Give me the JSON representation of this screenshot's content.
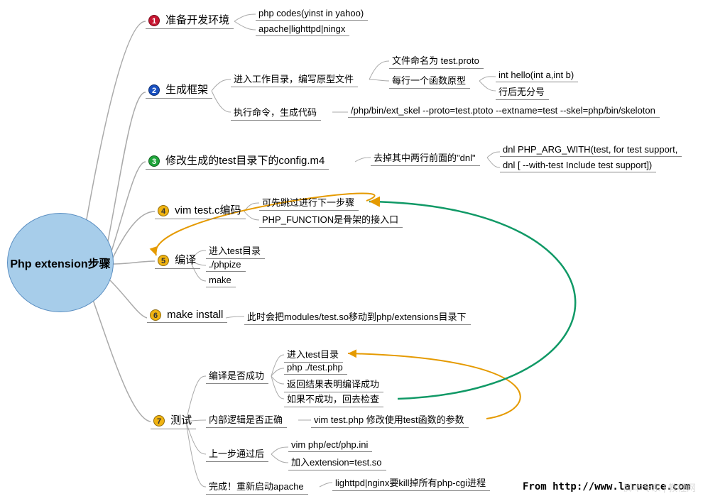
{
  "center": "Php extension步骤",
  "footer": "From  http://www.laruence.com",
  "watermark": "脚本专家 | 教程网",
  "branches": {
    "b1": {
      "num": "1",
      "label": "准备开发环境",
      "leaves": {
        "l1": "php codes(yinst in yahoo)",
        "l2": "apache|lighttpd|ningx"
      }
    },
    "b2": {
      "num": "2",
      "label": "生成框架",
      "sub": {
        "s1": "进入工作目录，编写原型文件",
        "s2": "执行命令，生成代码",
        "s1leaves": {
          "a": "文件命名为 test.proto",
          "b": "每行一个函数原型",
          "c": "int hello(int a,int b)",
          "d": "行后无分号"
        },
        "s2leaf": "/php/bin/ext_skel --proto=test.ptoto --extname=test --skel=php/bin/skeloton"
      }
    },
    "b3": {
      "num": "3",
      "label": "修改生成的test目录下的config.m4",
      "sub": "去掉其中两行前面的\"dnl\"",
      "leaves": {
        "a": "dnl PHP_ARG_WITH(test, for test support,",
        "b": "dnl [   --with-test            Include test support])"
      }
    },
    "b4": {
      "num": "4",
      "label": "vim test.c编码",
      "leaves": {
        "a": "可先跳过进行下一步骤",
        "b": "PHP_FUNCTION是骨架的接入口"
      }
    },
    "b5": {
      "num": "5",
      "label": "编译",
      "leaves": {
        "a": "进入test目录",
        "b": "./phpize",
        "c": "make"
      }
    },
    "b6": {
      "num": "6",
      "label": "make install",
      "leaf": "此时会把modules/test.so移动到php/extensions目录下"
    },
    "b7": {
      "num": "7",
      "label": "测试",
      "sub": {
        "s1": "编译是否成功",
        "s2": "内部逻辑是否正确",
        "s3": "上一步通过后",
        "s4": "完成！重新启动apache",
        "s1leaves": {
          "a": "进入test目录",
          "b": "php ./test.php",
          "c": "返回结果表明编译成功",
          "d": "如果不成功，回去检查"
        },
        "s2leaf": "vim test.php 修改使用test函数的参数",
        "s3leaves": {
          "a": "vim php/ect/php.ini",
          "b": "加入extension=test.so"
        },
        "s4leaf": "lighttpd|nginx要kill掉所有php-cgi进程"
      }
    }
  }
}
